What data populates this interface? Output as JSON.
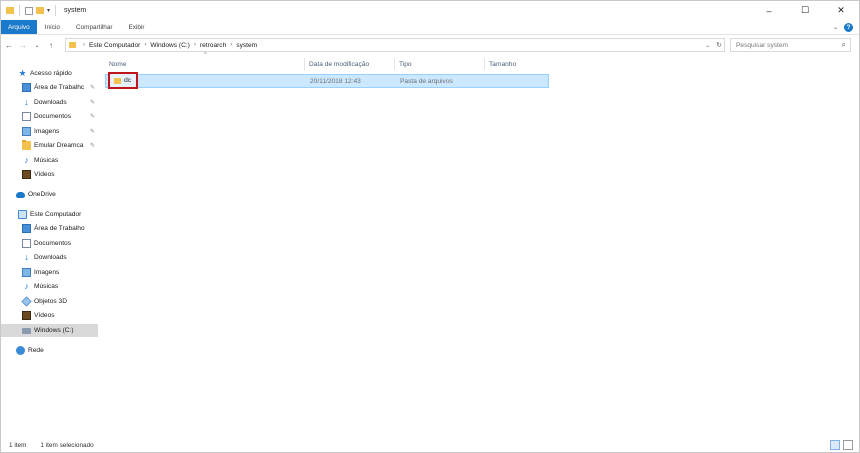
{
  "window": {
    "title": "system",
    "controls": {
      "minimize": "–",
      "maximize": "☐",
      "close": "✕"
    }
  },
  "ribbon": {
    "tabs": [
      "Arquivo",
      "Início",
      "Compartilhar",
      "Exibir"
    ]
  },
  "address": {
    "crumbs": [
      "Este Computador",
      "Windows (C:)",
      "retroarch",
      "system"
    ]
  },
  "search": {
    "placeholder": "Pesquisar system"
  },
  "sidebar": {
    "quick_access": "Acesso rápido",
    "quick_items": [
      "Área de Trabalhc",
      "Downloads",
      "Documentos",
      "Imagens",
      "Emular Dreamca",
      "Músicas",
      "Vídeos"
    ],
    "onedrive": "OneDrive",
    "this_pc": "Este Computador",
    "pc_items": [
      "Área de Trabalho",
      "Documentos",
      "Downloads",
      "Imagens",
      "Músicas",
      "Objetos 3D",
      "Vídeos",
      "Windows (C:)"
    ],
    "network": "Rede"
  },
  "columns": {
    "name": "Nome",
    "date": "Data de modificação",
    "type": "Tipo",
    "size": "Tamanho"
  },
  "files": [
    {
      "name": "dc",
      "date": "20/11/2018 12:43",
      "type": "Pasta de arquivos",
      "size": ""
    }
  ],
  "status": {
    "count": "1 item",
    "selected": "1 item selecionado"
  },
  "colors": {
    "accent": "#1979ca",
    "selection": "#cce8ff",
    "highlight_border": "#c0151b"
  }
}
